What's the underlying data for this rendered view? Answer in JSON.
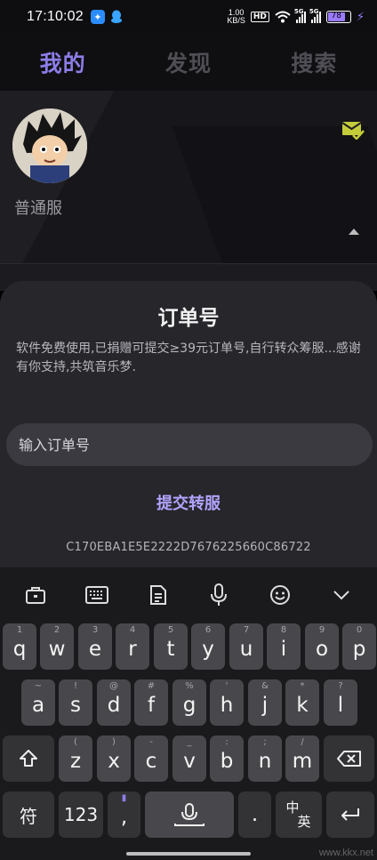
{
  "status_bar": {
    "time": "17:10:02",
    "net_speed_value": "1.00",
    "net_speed_unit": "KB/S",
    "hd_label": "HD",
    "signal1_label": "5G",
    "signal2_label": "5G",
    "battery_level": "78",
    "accent_color": "#9b7bff"
  },
  "tabs": [
    {
      "label": "我的",
      "active": true
    },
    {
      "label": "发现",
      "active": false
    },
    {
      "label": "搜索",
      "active": false
    }
  ],
  "profile": {
    "username": "普通服",
    "mail_icon_color": "#c5cc3a"
  },
  "sheet": {
    "title": "订单号",
    "description": "软件免费使用,已捐赠可提交≥39元订单号,自行转众筹服...感谢有你支持,共筑音乐梦.",
    "input_placeholder": "输入订单号",
    "submit_label": "提交转服",
    "device_code": "C170EBA1E5E2222D7676225660C86722"
  },
  "keyboard": {
    "toolbar": [
      "briefcase-icon",
      "keyboard-icon",
      "clipboard-icon",
      "mic-icon",
      "emoji-icon",
      "chevron-down-icon"
    ],
    "row1": [
      {
        "key": "q",
        "hint": "1"
      },
      {
        "key": "w",
        "hint": "2"
      },
      {
        "key": "e",
        "hint": "3"
      },
      {
        "key": "r",
        "hint": "4"
      },
      {
        "key": "t",
        "hint": "5"
      },
      {
        "key": "y",
        "hint": "6"
      },
      {
        "key": "u",
        "hint": "7"
      },
      {
        "key": "i",
        "hint": "8"
      },
      {
        "key": "o",
        "hint": "9"
      },
      {
        "key": "p",
        "hint": "0"
      }
    ],
    "row2": [
      {
        "key": "a",
        "hint": "~"
      },
      {
        "key": "s",
        "hint": "!"
      },
      {
        "key": "d",
        "hint": "@"
      },
      {
        "key": "f",
        "hint": "#"
      },
      {
        "key": "g",
        "hint": "%"
      },
      {
        "key": "h",
        "hint": "'"
      },
      {
        "key": "j",
        "hint": "&"
      },
      {
        "key": "k",
        "hint": "*"
      },
      {
        "key": "l",
        "hint": "?"
      }
    ],
    "row3": [
      {
        "key": "z",
        "hint": "("
      },
      {
        "key": "x",
        "hint": ")"
      },
      {
        "key": "c",
        "hint": "-"
      },
      {
        "key": "v",
        "hint": "_"
      },
      {
        "key": "b",
        "hint": ":"
      },
      {
        "key": "n",
        "hint": ";"
      },
      {
        "key": "m",
        "hint": "/"
      }
    ],
    "symbol_key": "符",
    "numbers_key": "123",
    "comma_key": ",",
    "period_key": ".",
    "lang_key_top": "中",
    "lang_key_bottom": "英"
  },
  "watermark": "www.kkx.net"
}
